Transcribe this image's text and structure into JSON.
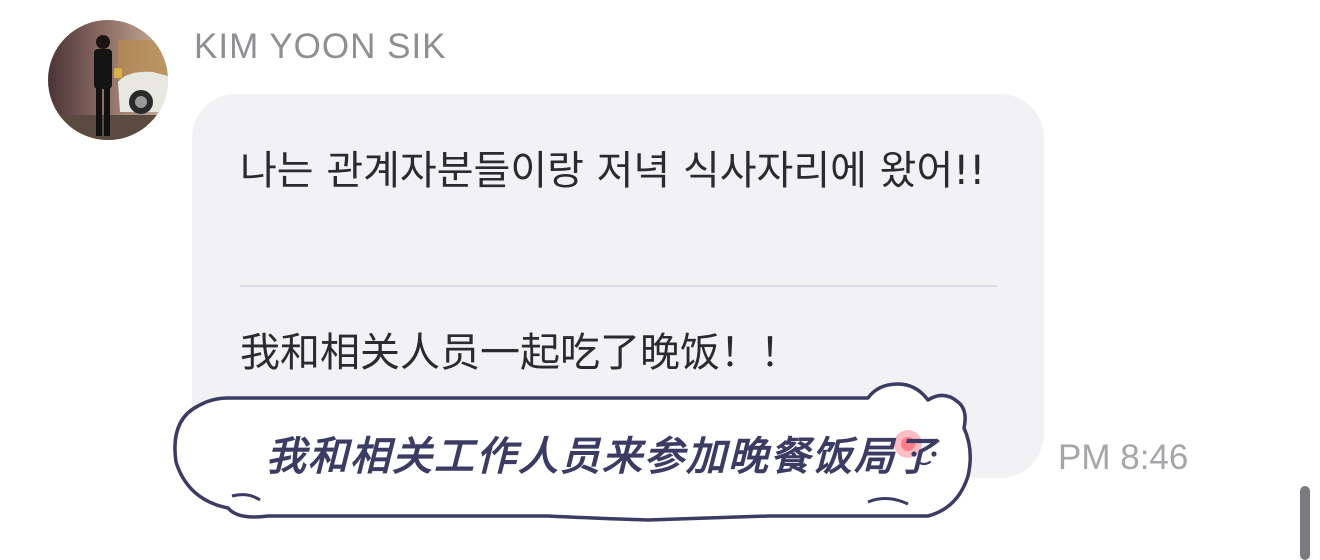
{
  "message": {
    "sender": "KIM YOON SIK",
    "text_ko": "나는 관계자분들이랑 저녁 식사자리에 왔어!!",
    "text_zh": "我和相关人员一起吃了晚饭！！",
    "time": "PM 8:46"
  },
  "sticker": {
    "text": "我和相关工作人员来参加晚餐饭局了",
    "icon": "cat-face-icon"
  },
  "avatar": {
    "icon": "profile-photo"
  },
  "colors": {
    "bubble": "#f2f2f5",
    "text": "#2b2b2e",
    "meta": "#8e8e93",
    "sticker_outline": "#3c3b63",
    "blush": "#ff6b78"
  }
}
